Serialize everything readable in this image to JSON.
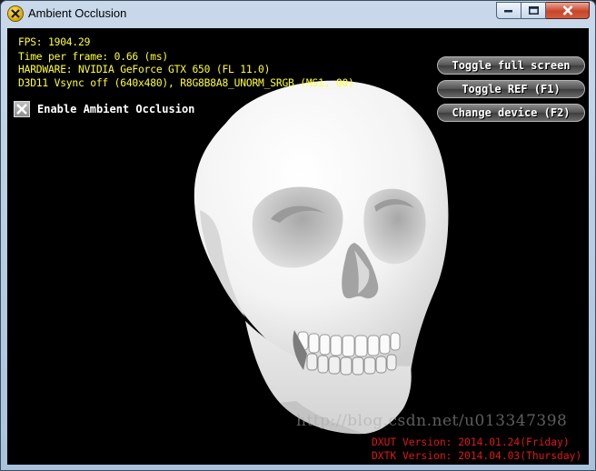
{
  "window": {
    "title": "Ambient Occlusion",
    "icon": "directx-icon",
    "controls": {
      "minimize": "minimize-icon",
      "maximize": "maximize-icon",
      "close": "close-icon"
    }
  },
  "stats": {
    "fps": "FPS: 1904.29",
    "frame_time": "Time per frame: 0.66 (ms)",
    "hardware": "HARDWARE: NVIDIA GeForce GTX 650 (FL 11.0)",
    "device": "D3D11 Vsync off (640x480), R8G8B8A8_UNORM_SRGB (MS1, Q0)"
  },
  "options": {
    "ambient_occlusion": {
      "label": "Enable Ambient Occlusion",
      "checked": true
    }
  },
  "buttons": {
    "toggle_fullscreen": "Toggle full screen",
    "toggle_ref": "Toggle REF (F1)",
    "change_device": "Change device (F2)"
  },
  "versions": {
    "dxut": "DXUT Version: 2014.01.24(Friday)",
    "dxtk": "DXTK Version: 2014.04.03(Thursday)"
  },
  "watermark": "http://blog.csdn.net/u013347398",
  "scene": {
    "subject": "skull-model",
    "background": "#000000",
    "text_color": "#ffff33",
    "version_color": "#e01818"
  }
}
